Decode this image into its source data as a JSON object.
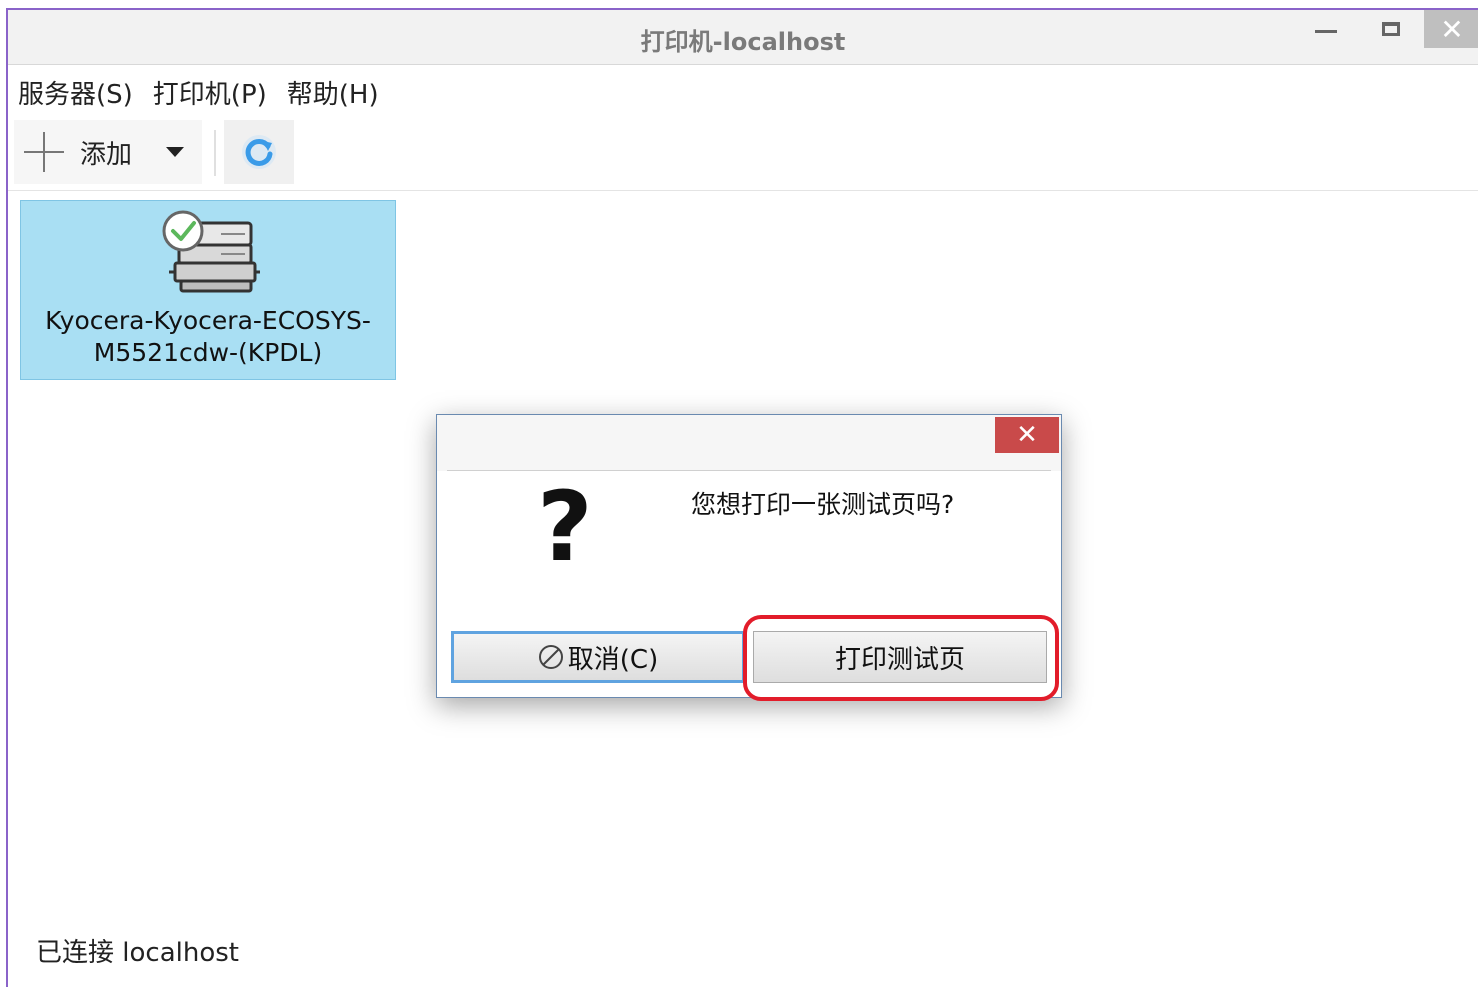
{
  "window": {
    "title": "打印机-localhost",
    "close_symbol": "✕",
    "accent_border": "#8a63c9"
  },
  "menubar": {
    "items": [
      {
        "label": "服务器(S)"
      },
      {
        "label": "打印机(P)"
      },
      {
        "label": "帮助(H)"
      }
    ]
  },
  "toolbar": {
    "add_label": "添加",
    "add_icon": "plus-icon",
    "dropdown_icon": "caret-down-icon",
    "refresh_icon": "refresh-icon",
    "refresh_color": "#3a9be8"
  },
  "printers": [
    {
      "name_line1": "Kyocera-Kyocera-ECOSYS-",
      "name_line2": "M5521cdw-(KPDL)",
      "status_icon": "check-icon",
      "tile_color": "#a9dff3"
    }
  ],
  "statusbar": {
    "text": "已连接 localhost"
  },
  "dialog": {
    "close_symbol": "✕",
    "question_mark": "?",
    "message": "您想打印一张测试页吗?",
    "cancel_label": "取消(C)",
    "print_label": "打印测试页",
    "close_color": "#c94a4a",
    "highlight_color": "#e21c2a"
  }
}
